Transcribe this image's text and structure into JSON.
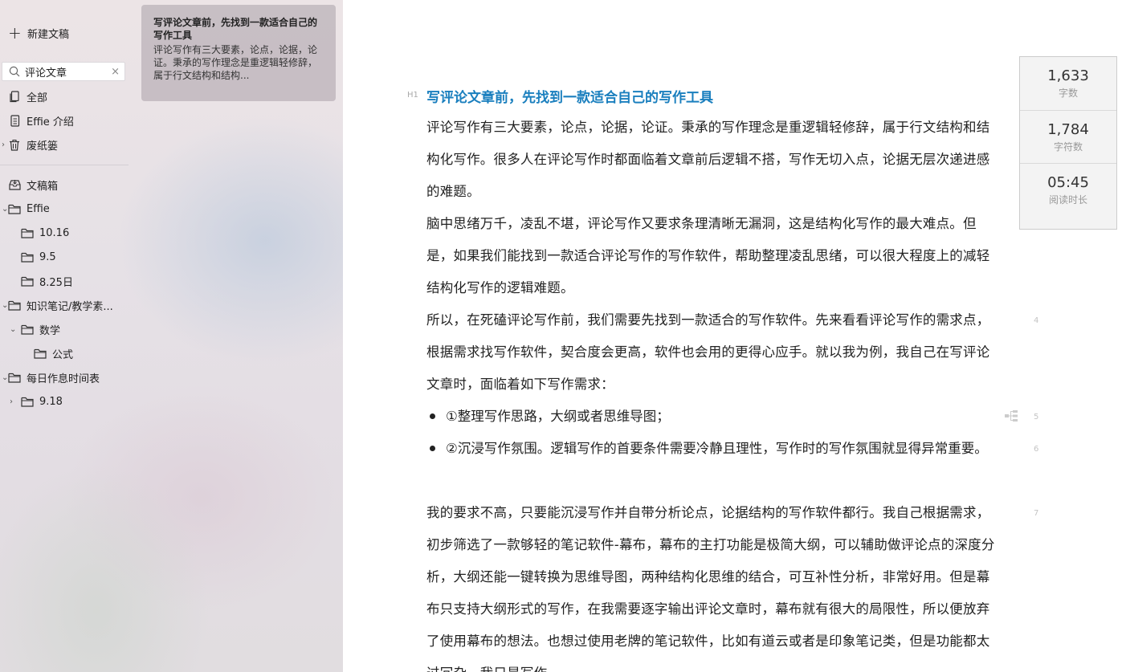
{
  "sidebar": {
    "new_doc": "新建文稿",
    "search": {
      "value": "评论文章",
      "clear": "×"
    },
    "items": [
      {
        "label": "全部"
      },
      {
        "label": "Effie 介绍"
      },
      {
        "label": "废纸篓"
      },
      {
        "label": "文稿箱"
      },
      {
        "label": "Effie"
      },
      {
        "label": "10.16"
      },
      {
        "label": "9.5"
      },
      {
        "label": "8.25日"
      },
      {
        "label": "知识笔记/教学素..."
      },
      {
        "label": "数学"
      },
      {
        "label": "公式"
      },
      {
        "label": "每日作息时间表"
      },
      {
        "label": "9.18"
      }
    ]
  },
  "card": {
    "title": "写评论文章前，先找到一款适合自己的写作工具",
    "excerpt": "评论写作有三大要素，论点，论据，论证。秉承的写作理念是重逻辑轻修辞，属于行文结构和结构..."
  },
  "editor": {
    "heading_tag": "H1",
    "title": "写评论文章前，先找到一款适合自己的写作工具",
    "paragraphs": [
      "评论写作有三大要素，论点，论据，论证。秉承的写作理念是重逻辑轻修辞，属于行文结构和结构化写作。很多人在评论写作时都面临着文章前后逻辑不搭，写作无切入点，论据无层次递进感的难题。",
      "脑中思绪万千，凌乱不堪，评论写作又要求条理清晰无漏洞，这是结构化写作的最大难点。但是，如果我们能找到一款适合评论写作的写作软件，帮助整理凌乱思绪，可以很大程度上的减轻结构化写作的逻辑难题。",
      "所以，在死磕评论写作前，我们需要先找到一款适合的写作软件。先来看看评论写作的需求点，根据需求找写作软件，契合度会更高，软件也会用的更得心应手。就以我为例，我自己在写评论文章时，面临着如下写作需求：",
      "①整理写作思路，大纲或者思维导图；",
      "②沉浸写作氛围。逻辑写作的首要条件需要冷静且理性，写作时的写作氛围就显得异常重要。",
      "我的要求不高，只要能沉浸写作并自带分析论点，论据结构的写作软件都行。我自己根据需求，初步筛选了一款够轻的笔记软件-幕布，幕布的主打功能是极简大纲，可以辅助做评论点的深度分析，大纲还能一键转换为思维导图，两种结构化思维的结合，可互补性分析，非常好用。但是幕布只支持大纲形式的写作，在我需要逐字输出评论文章时，幕布就有很大的局限性，所以便放弃了使用幕布的想法。也想过使用老牌的笔记软件，比如有道云或者是印象笔记类，但是功能都太过冗杂，我只是写作"
    ],
    "line_numbers": [
      "4",
      "5",
      "6",
      "7"
    ]
  },
  "stats": [
    {
      "value": "1,633",
      "label": "字数"
    },
    {
      "value": "1,784",
      "label": "字符数"
    },
    {
      "value": "05:45",
      "label": "阅读时长"
    }
  ]
}
